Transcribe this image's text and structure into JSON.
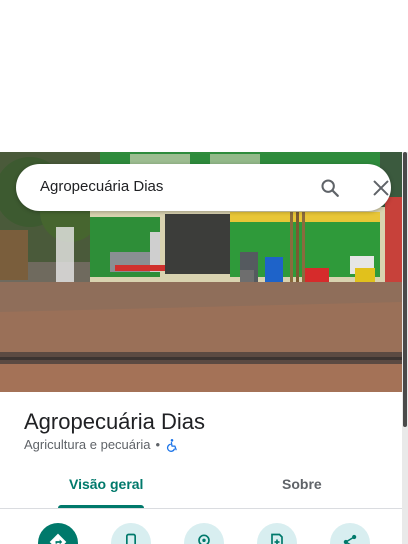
{
  "search": {
    "query": "Agropecuária Dias"
  },
  "place": {
    "name": "Agropecuária Dias",
    "category": "Agricultura e pecuária",
    "separator": "•"
  },
  "tabs": [
    {
      "label": "Visão geral",
      "selected": true
    },
    {
      "label": "Sobre",
      "selected": false
    }
  ],
  "actions": [
    {
      "icon": "directions-icon",
      "primary": true
    },
    {
      "icon": "phone-icon",
      "primary": false
    },
    {
      "icon": "location-icon",
      "primary": false
    },
    {
      "icon": "save-icon",
      "primary": false
    },
    {
      "icon": "share-icon",
      "primary": false
    }
  ],
  "colors": {
    "accent": "#00796b",
    "action_bg": "#d8eef0",
    "wheelchair": "#1a73e8"
  }
}
